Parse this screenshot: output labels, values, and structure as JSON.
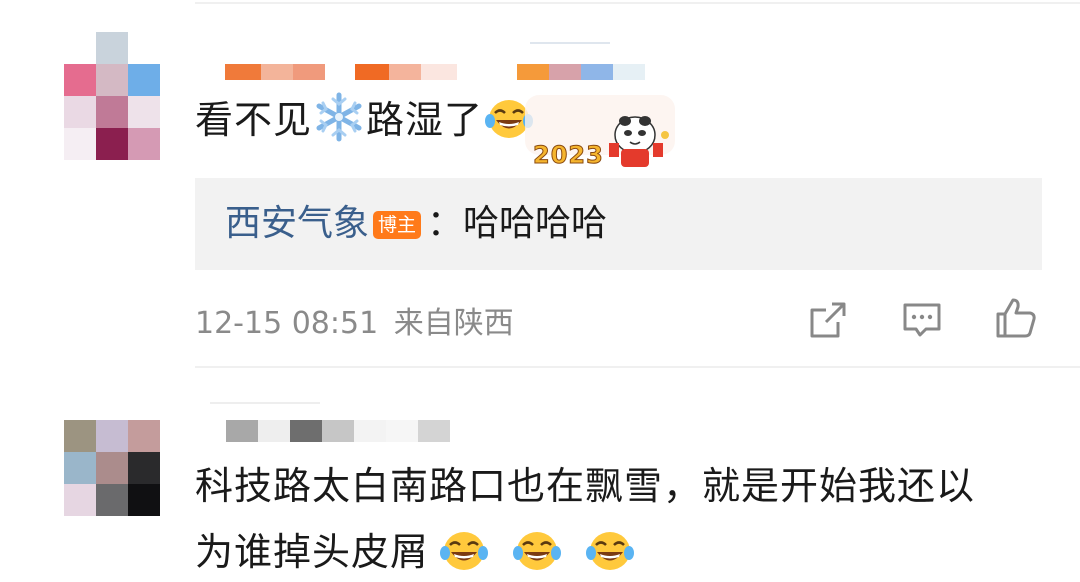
{
  "comment1": {
    "text_before_icon": "看不见",
    "text_after_icon": "路湿了",
    "reply": {
      "author": "西安气象",
      "badge": "博主",
      "separator": "：",
      "text": "哈哈哈哈"
    },
    "timestamp": "12-15 08:51",
    "location": "来自陕西",
    "sticker_text": "2023"
  },
  "comment2": {
    "line1": "科技路太白南路口也在飘雪，就是开始我还以",
    "line2": "为谁掉头皮屑"
  },
  "colors": {
    "reply_name": "#3a5f8c",
    "badge_bg": "#ff7a1a",
    "meta_gray": "#8a8a8a",
    "reply_bg": "#f2f2f2"
  },
  "icons": [
    "snowflake-icon",
    "laughing-tears-emoji",
    "share-icon",
    "comment-icon",
    "like-icon"
  ]
}
